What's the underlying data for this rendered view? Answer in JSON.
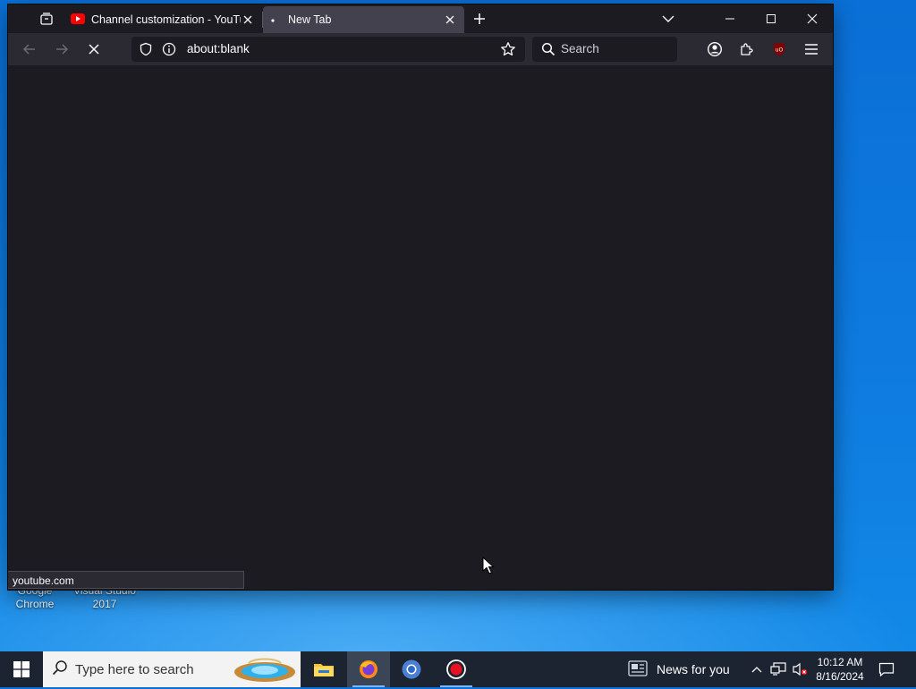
{
  "desktop": {
    "icons": [
      {
        "label_line1": "Google",
        "label_line2": "Chrome"
      },
      {
        "label_line1": "Visual Studio",
        "label_line2": "2017"
      }
    ]
  },
  "browser": {
    "tabs": [
      {
        "title": "Channel customization - YouTube",
        "favicon": "youtube-favicon",
        "active": false
      },
      {
        "title": "New Tab",
        "favicon": "loading-dot",
        "active": true
      }
    ],
    "url": "about:blank",
    "search_placeholder": "Search",
    "status_text": "youtube.com"
  },
  "taskbar": {
    "search_placeholder": "Type here to search",
    "news_label": "News for you",
    "time": "10:12 AM",
    "date": "8/16/2024"
  },
  "colors": {
    "browser_bg": "#1c1b22",
    "toolbar_bg": "#2b2a33",
    "active_tab": "#42414d",
    "taskbar_bg": "#1b2430",
    "desktop_blue": "#0e7be0"
  }
}
